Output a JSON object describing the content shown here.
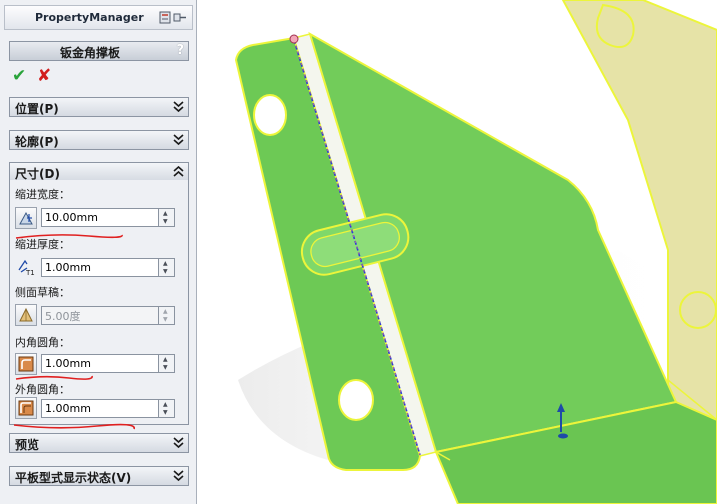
{
  "panel": {
    "title": "PropertyManager",
    "feature_title": "钣金角撑板",
    "help_label": "?",
    "ok_glyph": "✔",
    "cancel_glyph": "✘",
    "groups": {
      "position": "位置(P)",
      "profile": "轮廓(P)",
      "dimensions": "尺寸(D)",
      "preview": "预览",
      "flat_pattern": "平板型式显示状态(V)"
    },
    "fields": {
      "indent_width": {
        "label": "缩进宽度：",
        "value": "10.00mm"
      },
      "indent_thickness": {
        "label": "缩进厚度：",
        "value": "1.00mm"
      },
      "side_draft": {
        "label": "侧面草稿：",
        "value": "5.00度"
      },
      "inner_fillet": {
        "label": "内角圆角：",
        "value": "1.00mm"
      },
      "outer_fillet": {
        "label": "外角圆角：",
        "value": "1.00mm"
      }
    },
    "icon_labels": {
      "t1": "T1"
    }
  },
  "colors": {
    "panel_bg": "#eef0f4",
    "part_green": "#6dc955",
    "part_green_light": "#7fd86a",
    "edge_yellow": "#ecf53b",
    "ghost_yellow": "#e6e3a7",
    "annotation_red": "#e02020"
  }
}
